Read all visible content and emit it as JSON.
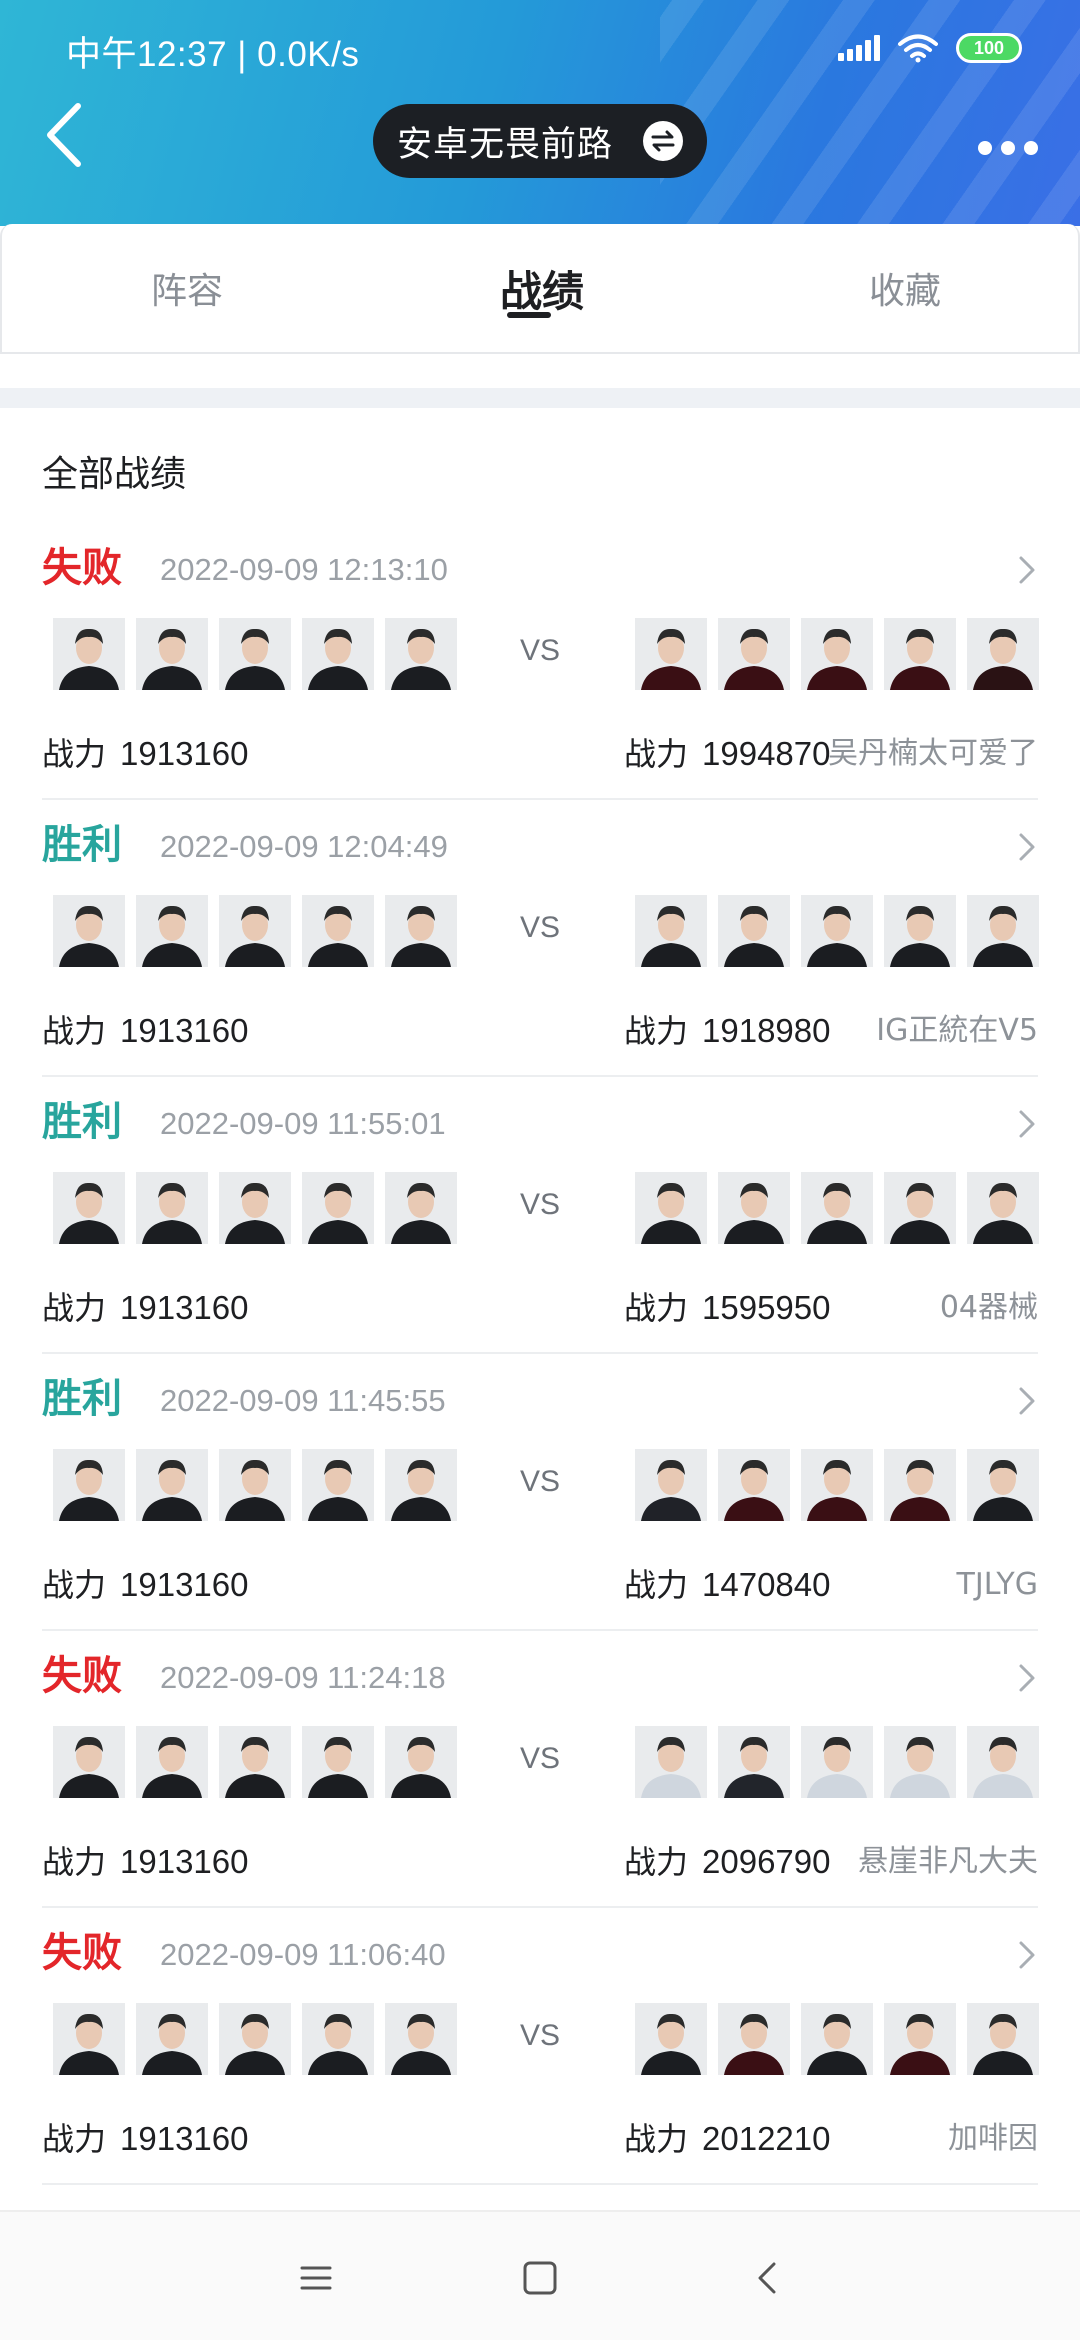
{
  "status_bar": {
    "time": "中午12:37 | 0.0K/s",
    "battery": "100"
  },
  "header": {
    "title": "安卓无畏前路"
  },
  "tabs": [
    {
      "label": "阵容",
      "active": false
    },
    {
      "label": "战绩",
      "active": true
    },
    {
      "label": "收藏",
      "active": false
    }
  ],
  "section": {
    "title": "全部战绩"
  },
  "power_label": "战力",
  "vs_label": "VS",
  "colors": {
    "win": "#28a59d",
    "lose": "#e3262a",
    "header_start": "#2fb6d6",
    "header_end": "#3a6fe6"
  },
  "matches": [
    {
      "result": "失败",
      "outcome": "lose",
      "datetime": "2022-09-09 12:13:10",
      "my_power": "1913160",
      "opp_power": "1994870",
      "opp_name": "吴丹楠太可爱了"
    },
    {
      "result": "胜利",
      "outcome": "win",
      "datetime": "2022-09-09 12:04:49",
      "my_power": "1913160",
      "opp_power": "1918980",
      "opp_name": "IG正統在V5"
    },
    {
      "result": "胜利",
      "outcome": "win",
      "datetime": "2022-09-09 11:55:01",
      "my_power": "1913160",
      "opp_power": "1595950",
      "opp_name": "04器械"
    },
    {
      "result": "胜利",
      "outcome": "win",
      "datetime": "2022-09-09 11:45:55",
      "my_power": "1913160",
      "opp_power": "1470840",
      "opp_name": "TJLYG"
    },
    {
      "result": "失败",
      "outcome": "lose",
      "datetime": "2022-09-09 11:24:18",
      "my_power": "1913160",
      "opp_power": "2096790",
      "opp_name": "悬崖非凡大夫"
    },
    {
      "result": "失败",
      "outcome": "lose",
      "datetime": "2022-09-09 11:06:40",
      "my_power": "1913160",
      "opp_power": "2012210",
      "opp_name": "加啡因"
    }
  ]
}
